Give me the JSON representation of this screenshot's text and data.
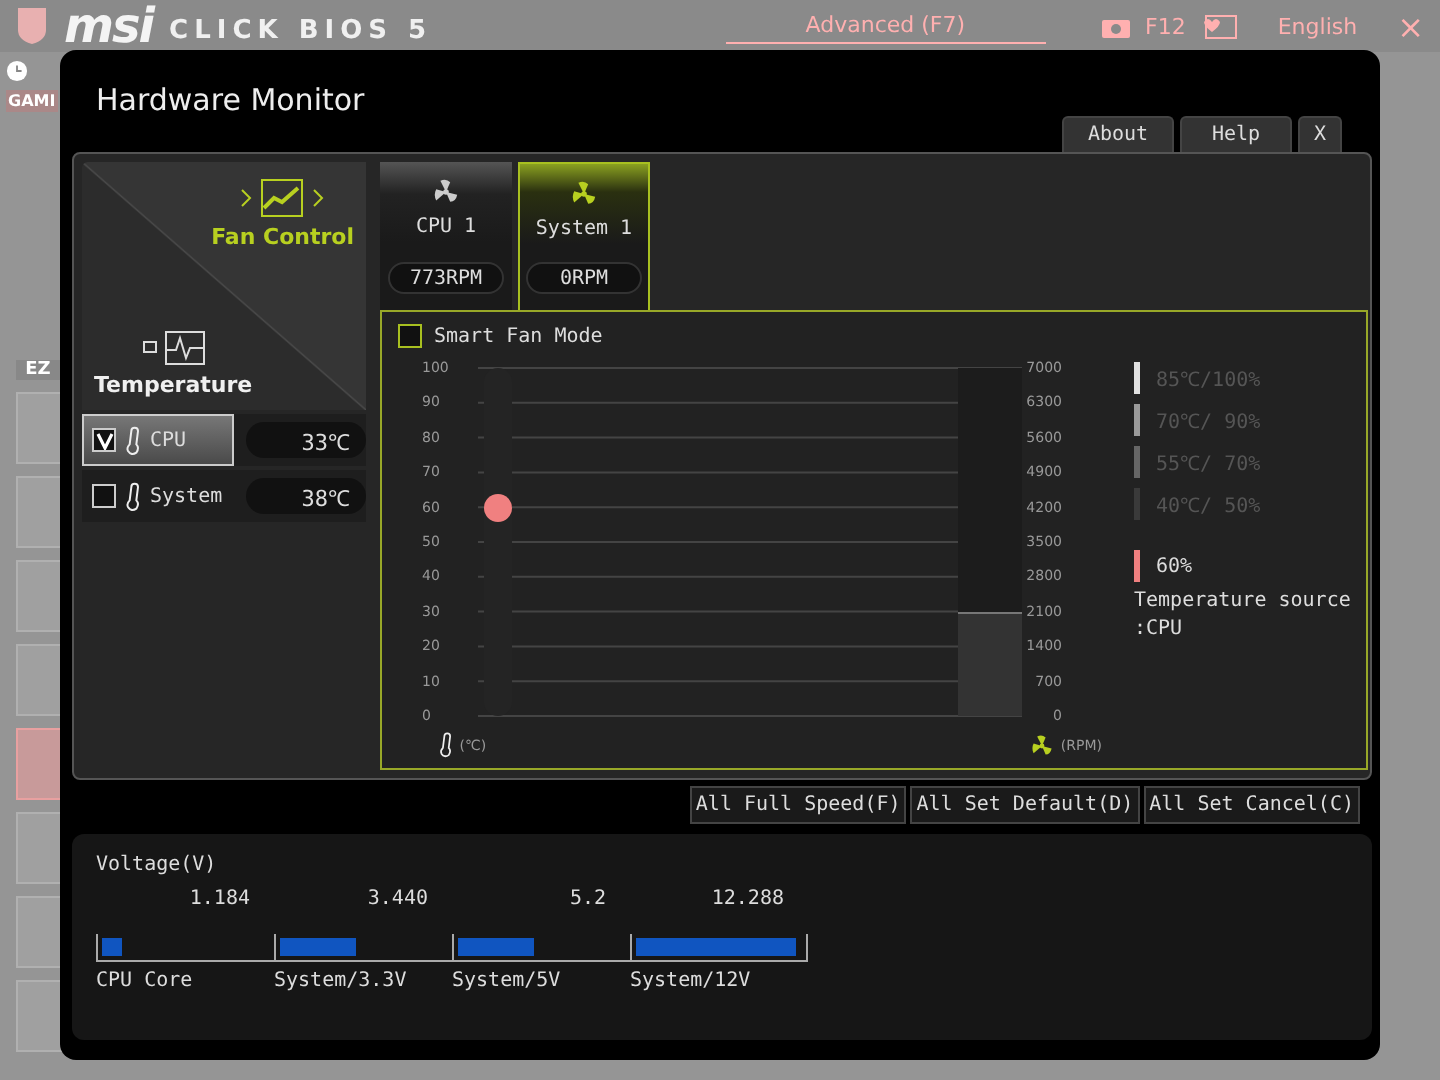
{
  "header": {
    "brand": "msi",
    "product": "CLICK BIOS 5",
    "mode_tab": "Advanced (F7)",
    "screenshot_key": "F12",
    "language": "English",
    "close": "×"
  },
  "background": {
    "game_label": "GAMI",
    "ez_label": "EZ"
  },
  "dialog": {
    "title": "Hardware Monitor",
    "buttons": [
      "About",
      "Help",
      "X"
    ],
    "modes": [
      {
        "label": "Fan Control",
        "selected": true
      },
      {
        "label": "Temperature",
        "selected": false
      }
    ],
    "sensors": [
      {
        "name": "CPU",
        "checked": true,
        "selected": true,
        "reading": "33℃"
      },
      {
        "name": "System",
        "checked": false,
        "selected": false,
        "reading": "38℃"
      }
    ],
    "fans": [
      {
        "name": "CPU 1",
        "speed": "773RPM",
        "selected": false
      },
      {
        "name": "System 1",
        "speed": "0RPM",
        "selected": true
      }
    ],
    "smart_fan": {
      "label": "Smart Fan Mode",
      "checked": false
    },
    "fan_curve": {
      "left_ticks": [
        "100",
        "90",
        "80",
        "70",
        "60",
        "50",
        "40",
        "30",
        "20",
        "10",
        "0"
      ],
      "right_ticks": [
        "7000",
        "6300",
        "5600",
        "4900",
        "4200",
        "3500",
        "2800",
        "2100",
        "1400",
        "700",
        "0"
      ],
      "point": {
        "level": 0.6
      },
      "rpm_bar": {
        "level": 0.3
      },
      "left_unit": "(℃)",
      "right_unit": "(RPM)"
    },
    "legend": [
      {
        "label": "85℃/100%",
        "color": "#e0e0e0"
      },
      {
        "label": "70℃/ 90%",
        "color": "#9a9a9a"
      },
      {
        "label": "55℃/ 70%",
        "color": "#666666"
      },
      {
        "label": "40℃/ 50%",
        "color": "#3a3a3a"
      }
    ],
    "current": {
      "label": "60%",
      "color": "#f08080"
    },
    "temperature_source": {
      "label": "Temperature source",
      "value": ":CPU"
    },
    "actions": [
      "All Full Speed(F)",
      "All Set Default(D)",
      "All Set Cancel(C)"
    ],
    "voltage": {
      "title": "Voltage(V)",
      "items": [
        {
          "value": "1.184",
          "level": 0.12,
          "label": "CPU Core"
        },
        {
          "value": "3.440",
          "level": 0.45,
          "label": "System/3.3V"
        },
        {
          "value": "5.2",
          "level": 0.45,
          "label": "System/5V"
        },
        {
          "value": "12.288",
          "level": 0.96,
          "label": "System/12V"
        }
      ]
    }
  }
}
